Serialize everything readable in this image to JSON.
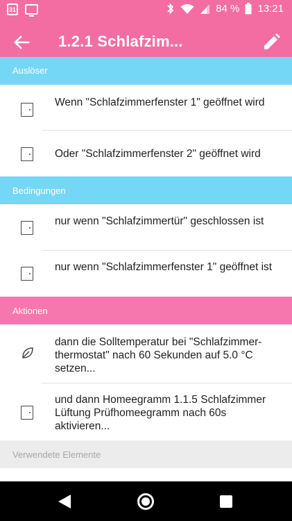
{
  "status_bar": {
    "calendar_day": "31",
    "battery": "84 %",
    "time": "13:21"
  },
  "app_bar": {
    "title": "1.2.1 Schlafzim..."
  },
  "sections": {
    "trigger": {
      "header": "Auslöser",
      "items": [
        {
          "text": "Wenn \"Schlafzimmerfenster 1\" geöffnet wird",
          "icon": "door-icon"
        },
        {
          "text": "Oder \"Schlafzimmerfenster 2\" geöffnet wird",
          "icon": "door-icon"
        }
      ]
    },
    "conditions": {
      "header": "Bedingungen",
      "items": [
        {
          "text": "nur wenn \"Schlafzimmertür\" geschlossen ist",
          "icon": "door-icon"
        },
        {
          "text": "nur wenn \"Schlafzimmerfenster 1\" geöffnet ist",
          "icon": "door-icon"
        }
      ]
    },
    "actions": {
      "header": "Aktionen",
      "items": [
        {
          "text": "dann die Solltemperatur bei \"Schlafzimmer-thermostat\"  nach 60 Sekunden auf 5.0 °C setzen...",
          "icon": "leaf-icon"
        },
        {
          "text": "und  dann Homeegramm 1.1.5 Schlafzimmer Lüftung Prüfhomeegramm nach 60s aktivieren...",
          "icon": "door-icon"
        }
      ]
    },
    "used_elements": {
      "header": "Verwendete Elemente"
    }
  },
  "colors": {
    "primary": "#f36da3",
    "cyan_header": "#74d7f5",
    "pink_header": "#f677ad",
    "grey_header": "#ececec"
  }
}
